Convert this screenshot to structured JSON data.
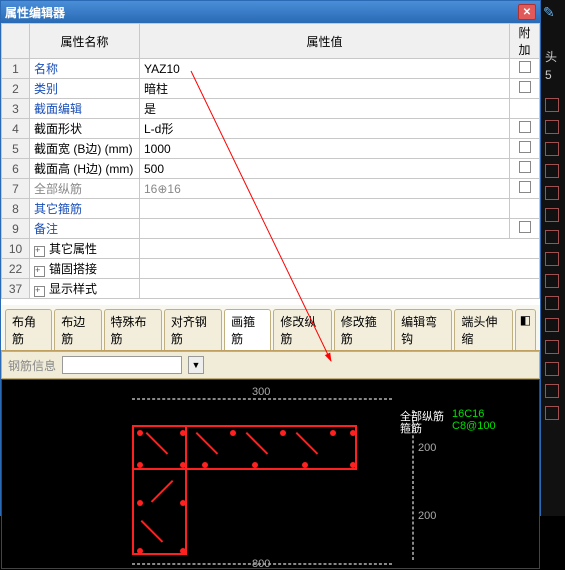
{
  "window": {
    "title": "属性编辑器"
  },
  "grid": {
    "headers": {
      "name": "属性名称",
      "value": "属性值",
      "extra": "附加"
    },
    "rows": [
      {
        "num": "1",
        "name": "名称",
        "value": "YAZ10",
        "link": true,
        "check": true
      },
      {
        "num": "2",
        "name": "类别",
        "value": "暗柱",
        "link": true,
        "check": true
      },
      {
        "num": "3",
        "name": "截面编辑",
        "value": "是",
        "link": true,
        "check": false
      },
      {
        "num": "4",
        "name": "截面形状",
        "value": "L-d形",
        "link": false,
        "check": true
      },
      {
        "num": "5",
        "name": "截面宽 (B边) (mm)",
        "value": "1000",
        "link": false,
        "check": true
      },
      {
        "num": "6",
        "name": "截面高 (H边) (mm)",
        "value": "500",
        "link": false,
        "check": true
      },
      {
        "num": "7",
        "name": "全部纵筋",
        "value": "16⊕16",
        "gray": true,
        "check": true
      },
      {
        "num": "8",
        "name": "其它箍筋",
        "value": "",
        "link": true,
        "check": false
      },
      {
        "num": "9",
        "name": "备注",
        "value": "",
        "link": true,
        "check": true
      },
      {
        "num": "10",
        "name": "其它属性",
        "value": "",
        "expand": true
      },
      {
        "num": "22",
        "name": "锚固搭接",
        "value": "",
        "expand": true
      },
      {
        "num": "37",
        "name": "显示样式",
        "value": "",
        "expand": true
      }
    ]
  },
  "tabs": [
    "布角筋",
    "布边筋",
    "特殊布筋",
    "对齐钢筋",
    "画箍筋",
    "修改纵筋",
    "修改箍筋",
    "编辑弯钩",
    "端头伸缩"
  ],
  "active_tab": 4,
  "infobar": {
    "label": "钢筋信息"
  },
  "canvas": {
    "annot1_label": "全部纵筋",
    "annot1_value": "16C16",
    "annot2_label": "箍筋",
    "annot2_value": "C8@100",
    "dim_h1": "200",
    "dim_h2": "200",
    "dim_w": "800",
    "ruler": "300"
  },
  "side": {
    "text1": "头",
    "text2": "5"
  }
}
